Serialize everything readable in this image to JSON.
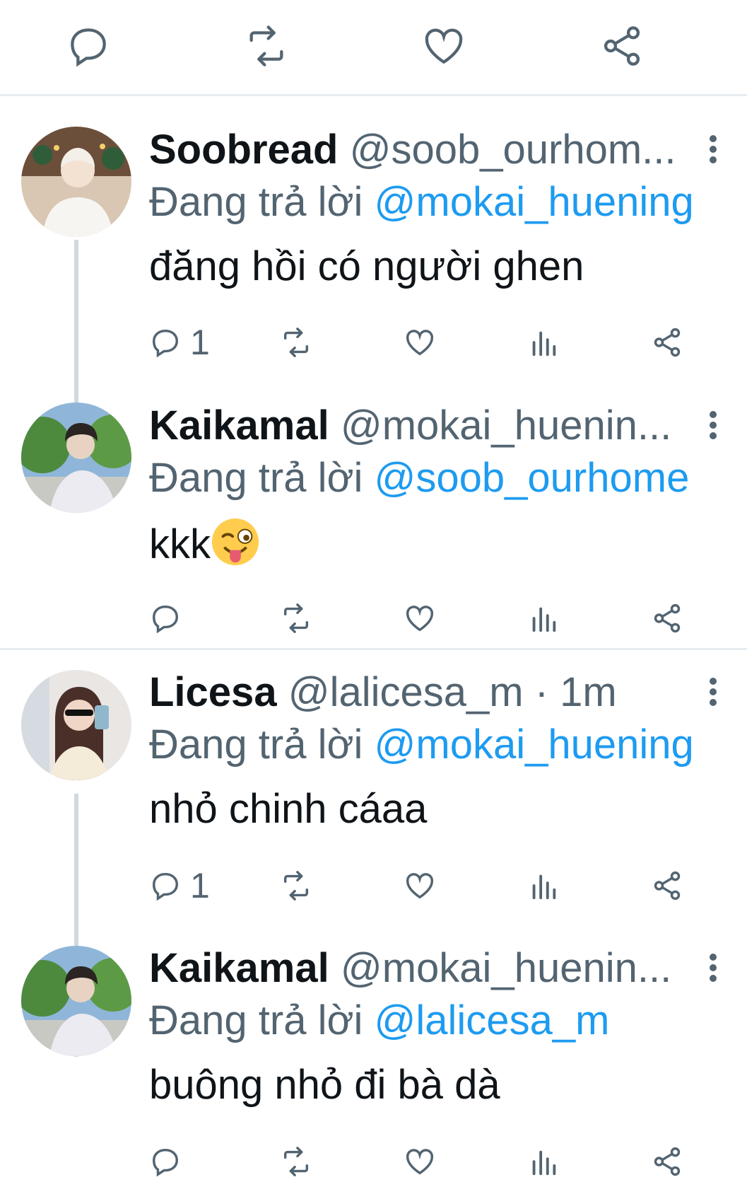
{
  "topbar": {
    "icons": [
      "reply-icon",
      "retweet-icon",
      "like-icon",
      "share-icon"
    ]
  },
  "tweets": [
    {
      "name": "Soobread",
      "handle": "@soob_ourhom...",
      "reply_prefix": "Đang trả lời",
      "reply_to": "@mokai_huening",
      "text": "đăng hồi có người ghen",
      "reply_count": "1"
    },
    {
      "name": "Kaikamal",
      "handle": "@mokai_huenin...",
      "reply_prefix": "Đang trả lời",
      "reply_to": "@soob_ourhome",
      "text": "kkk",
      "emoji": "winking-face-with-tongue",
      "reply_count": ""
    },
    {
      "name": "Licesa",
      "handle": "@lalicesa_m · 1m",
      "reply_prefix": "Đang trả lời",
      "reply_to": "@mokai_huening",
      "text": "nhỏ chinh cáaa",
      "reply_count": "1"
    },
    {
      "name": "Kaikamal",
      "handle": "@mokai_huenin...",
      "reply_prefix": "Đang trả lời",
      "reply_to": "@lalicesa_m",
      "text": "buông nhỏ đi bà dà",
      "reply_count": ""
    }
  ],
  "colors": {
    "accent": "#1d9bf0",
    "muted": "#536471",
    "text": "#0f1419",
    "divider": "#e6ecf0"
  }
}
